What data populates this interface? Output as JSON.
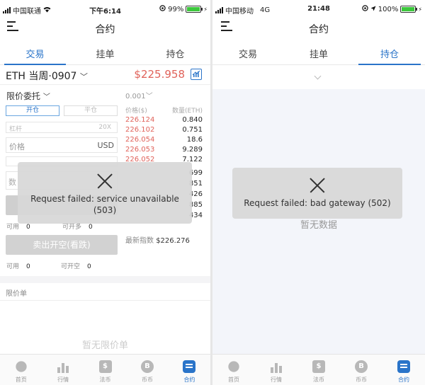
{
  "left": {
    "status": {
      "carrier": "中国联通",
      "time": "下午6:14",
      "battery": "99%",
      "battery_level": 0.99
    },
    "nav_title": "合约",
    "tabs": [
      "交易",
      "挂单",
      "持仓"
    ],
    "contract": {
      "name": "ETH 当周·0907",
      "price": "$225.958"
    },
    "form": {
      "order_type": "限价委托",
      "open_label": "开仓",
      "close_label": "平仓",
      "leverage_label": "杠杆",
      "leverage_value": "20X",
      "price_placeholder": "价格",
      "price_unit": "USD",
      "qty_prefix": "数",
      "avail_label": "可用",
      "avail_value": "0",
      "can_long_label": "可开多",
      "can_long_value": "0",
      "sell_label": "卖出开空(看跌)",
      "avail2_label": "可用",
      "avail2_value": "0",
      "can_short_label": "可开空",
      "can_short_value": "0"
    },
    "orderbook": {
      "depth": "0.001",
      "header_price": "价格($)",
      "header_qty": "数量(ETH)",
      "asks": [
        {
          "price": "226.124",
          "qty": "0.840"
        },
        {
          "price": "226.102",
          "qty": "0.751"
        },
        {
          "price": "226.054",
          "qty": "18.6"
        },
        {
          "price": "226.053",
          "qty": "9.289"
        },
        {
          "price": "226.052",
          "qty": "7.122"
        }
      ],
      "hidden_qty": [
        "699",
        "851",
        "426",
        "885",
        "434"
      ],
      "index_label": "最新指数",
      "index_value": "$226.276"
    },
    "limit_section_title": "限价单",
    "limit_empty": "暂无限价单",
    "toast": {
      "message": "Request failed: service unavailable (503)"
    }
  },
  "right": {
    "status": {
      "carrier": "中国移动",
      "network": "4G",
      "time": "21:48",
      "battery": "100%",
      "battery_level": 1.0
    },
    "nav_title": "合约",
    "tabs": [
      "交易",
      "挂单",
      "持仓"
    ],
    "empty": "暂无数据",
    "toast": {
      "message": "Request failed: bad gateway (502)"
    }
  },
  "tabbar": [
    "首页",
    "行情",
    "法币",
    "币币",
    "合约"
  ],
  "tabbar_icons": {
    "money": "$",
    "coin": "B"
  },
  "colors": {
    "accent": "#2a74c9",
    "ask": "#e0625a"
  }
}
